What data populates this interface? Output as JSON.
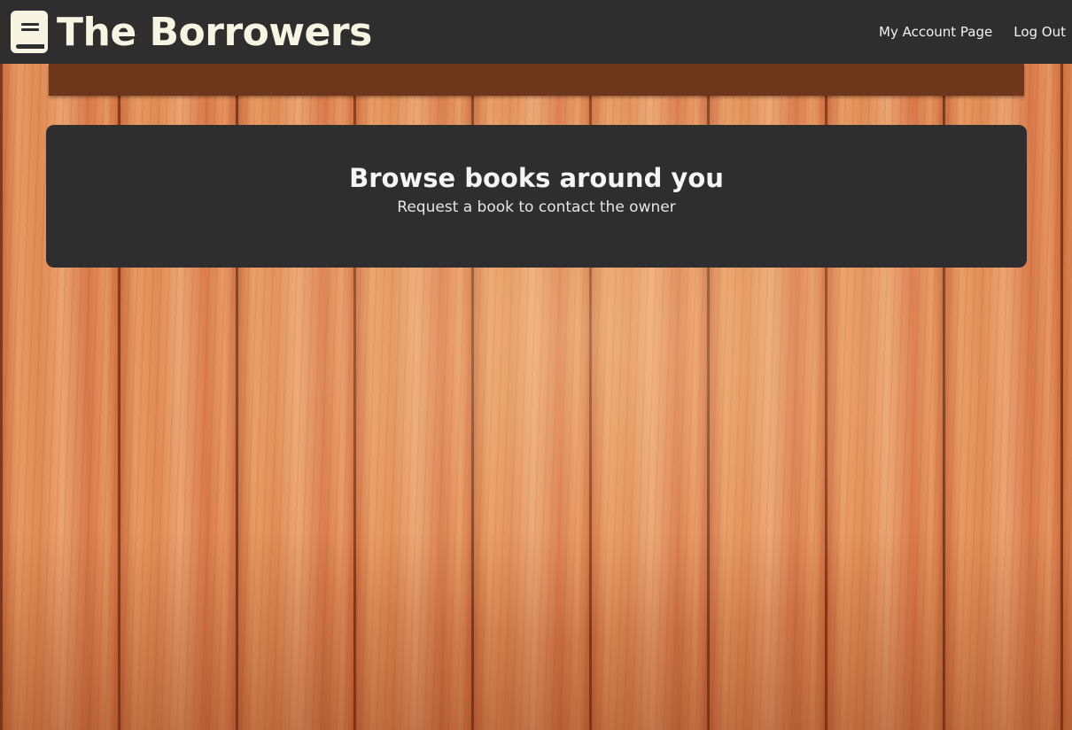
{
  "app": {
    "title": "The Borrowers",
    "logo_icon": "book-icon"
  },
  "nav": {
    "account_label": "My Account Page",
    "logout_label": "Log Out"
  },
  "hero": {
    "title": "Browse books around you",
    "subtitle": "Request a book to contact the owner"
  },
  "colors": {
    "navbar": "#2e2e2e",
    "logo_fg": "#f7f5e1",
    "strip": "#6e361b",
    "wood": "#e08b53"
  }
}
